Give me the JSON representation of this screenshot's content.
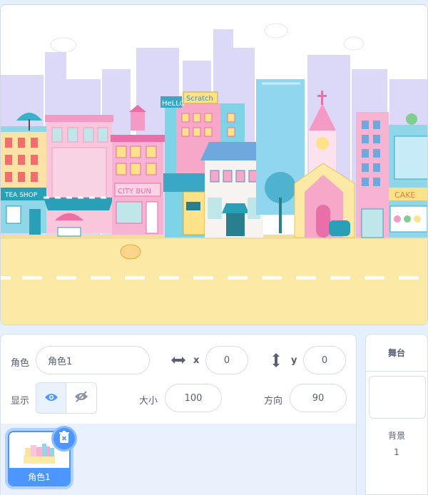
{
  "stage": {
    "sign_tea_shop": "TEA SHOP",
    "sign_hello": "HeLLO",
    "sign_scratch": "Scratch",
    "sign_city_bun": "CITY BUN",
    "sign_cake": "CAKE",
    "colors": {
      "sky": "#ffffff",
      "skyline": "#dcd8f8",
      "ground": "#fde9a6",
      "road_line": "#ffffff"
    }
  },
  "sprite_info": {
    "sprite_label": "角色",
    "sprite_name": "角色1",
    "x_label": "x",
    "x_value": "0",
    "y_label": "y",
    "y_value": "0",
    "show_label": "显示",
    "size_label": "大小",
    "size_value": "100",
    "direction_label": "方向",
    "direction_value": "90"
  },
  "sprite_list": {
    "items": [
      {
        "name": "角色1",
        "selected": true
      }
    ]
  },
  "stage_panel": {
    "title": "舞台",
    "backdrops_label": "背景",
    "backdrops_count": "1"
  },
  "accent_color": "#4c97ff"
}
